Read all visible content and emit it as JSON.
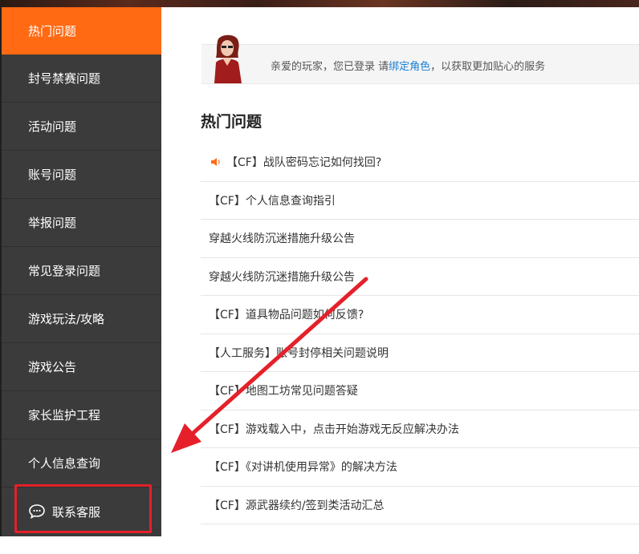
{
  "sidebar": {
    "items": [
      {
        "label": "热门问题",
        "active": true
      },
      {
        "label": "封号禁赛问题"
      },
      {
        "label": "活动问题"
      },
      {
        "label": "账号问题"
      },
      {
        "label": "举报问题"
      },
      {
        "label": "常见登录问题"
      },
      {
        "label": "游戏玩法/攻略"
      },
      {
        "label": "游戏公告"
      },
      {
        "label": "家长监护工程"
      },
      {
        "label": "个人信息查询"
      }
    ],
    "contact": {
      "label": "联系客服",
      "icon": "chat-bubble-icon"
    }
  },
  "user_bar": {
    "text_before": "亲爱的玩家，您已登录 请",
    "link": "绑定角色",
    "text_after": "，以获取更加贴心的服务"
  },
  "main": {
    "section_title": "热门问题",
    "faq": [
      "【CF】战队密码忘记如何找回?",
      "【CF】个人信息查询指引",
      "穿越火线防沉迷措施升级公告",
      "穿越火线防沉迷措施升级公告",
      "【CF】道具物品问题如何反馈?",
      "【人工服务】账号封停相关问题说明",
      "【CF】地图工坊常见问题答疑",
      "【CF】游戏载入中，点击开始游戏无反应解决办法",
      "【CF】《对讲机使用异常》的解决方法",
      "【CF】源武器续约/签到类活动汇总"
    ]
  },
  "colors": {
    "accent": "#ff6a13",
    "sidebar_bg": "#3b3b3b",
    "link": "#1a7fd4",
    "annotation_red": "#e5202a"
  }
}
